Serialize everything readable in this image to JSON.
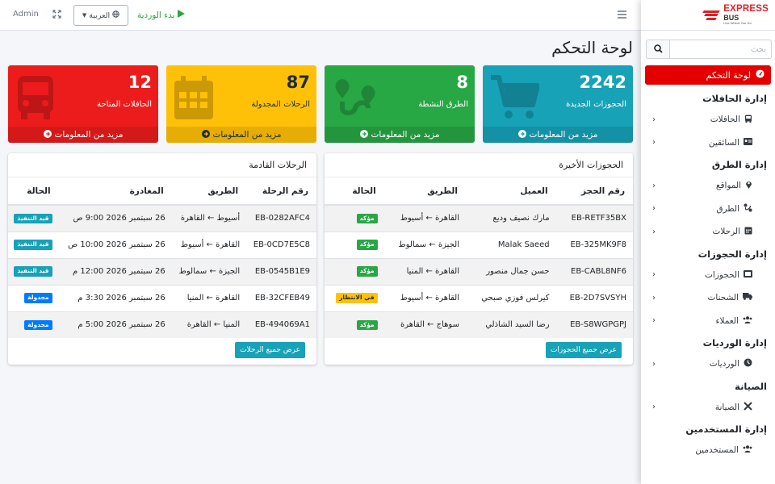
{
  "brand": {
    "line1": "EXPRESS",
    "line2": "BUS",
    "line3": "Live Where You Go",
    "accent": "#e31e24"
  },
  "topbar": {
    "user": "Admin",
    "language": "العربية",
    "start_shift": "بدء الوردية"
  },
  "sidebar": {
    "search_placeholder": "بحث",
    "active_item": "لوحة التحكم",
    "sections": [
      {
        "header": "إدارة الحافلات",
        "items": [
          {
            "label": "الحافلات",
            "icon": "bus-icon"
          },
          {
            "label": "السائقين",
            "icon": "id-card-icon"
          }
        ]
      },
      {
        "header": "إدارة الطرق",
        "items": [
          {
            "label": "المواقع",
            "icon": "map-marker-icon"
          },
          {
            "label": "الطرق",
            "icon": "route-icon"
          },
          {
            "label": "الرحلات",
            "icon": "calendar-icon"
          }
        ]
      },
      {
        "header": "إدارة الحجوزات",
        "items": [
          {
            "label": "الحجوزات",
            "icon": "ticket-icon"
          },
          {
            "label": "الشحنات",
            "icon": "truck-icon"
          },
          {
            "label": "العملاء",
            "icon": "users-icon"
          }
        ]
      },
      {
        "header": "إدارة الورديات",
        "items": [
          {
            "label": "الورديات",
            "icon": "clock-icon"
          }
        ]
      },
      {
        "header": "الصيانة",
        "items": [
          {
            "label": "الصيانة",
            "icon": "tools-icon"
          }
        ]
      },
      {
        "header": "إدارة المستخدمين",
        "items": [
          {
            "label": "المستخدمين",
            "icon": "users-icon"
          }
        ]
      }
    ]
  },
  "page": {
    "title": "لوحة التحكم"
  },
  "stats": [
    {
      "value": "2242",
      "label": "الحجوزات الجديدة",
      "footer": "مزيد من المعلومات",
      "color": "#17a2b8",
      "icon": "cart-icon"
    },
    {
      "value": "8",
      "label": "الطرق النشطة",
      "footer": "مزيد من المعلومات",
      "color": "#28a745",
      "icon": "route-icon"
    },
    {
      "value": "87",
      "label": "الرحلات المجدولة",
      "footer": "مزيد من المعلومات",
      "color": "#ffc107",
      "icon": "calendar-icon"
    },
    {
      "value": "12",
      "label": "الحافلات المتاحة",
      "footer": "مزيد من المعلومات",
      "color": "#ed1c1c",
      "icon": "bus-icon"
    }
  ],
  "recent_bookings": {
    "title": "الحجوزات الأخيرة",
    "columns": [
      "رقم الحجز",
      "العميل",
      "الطريق",
      "الحالة"
    ],
    "rows": [
      {
        "id": "EB-RETF35BX",
        "customer": "مارك نصيف وديع",
        "route": "القاهرة ← أسيوط",
        "status": "مؤكد"
      },
      {
        "id": "EB-325MK9F8",
        "customer": "Malak Saeed",
        "route": "الجيزة ← سمالوط",
        "status": "مؤكد"
      },
      {
        "id": "EB-CABL8NF6",
        "customer": "حسن جمال منصور",
        "route": "القاهرة ← المنيا",
        "status": "مؤكد"
      },
      {
        "id": "EB-2D7SVSYH",
        "customer": "كيرلس فوزي صبحي",
        "route": "القاهرة ← أسيوط",
        "status": "في الانتظار"
      },
      {
        "id": "EB-S8WGPGPJ",
        "customer": "رضا السيد الشاذلي",
        "route": "سوهاج ← القاهرة",
        "status": "مؤكد"
      }
    ],
    "button": "عرض جميع الحجوزات"
  },
  "upcoming_trips": {
    "title": "الرحلات القادمة",
    "columns": [
      "رقم الرحلة",
      "الطريق",
      "المغادرة",
      "الحالة"
    ],
    "rows": [
      {
        "id": "EB-0282AFC4",
        "route": "أسيوط ← القاهرة",
        "departure": "26 سبتمبر 2026 9:00 ص",
        "status": "قيد التنفيذ"
      },
      {
        "id": "EB-0CD7E5C8",
        "route": "القاهرة ← أسيوط",
        "departure": "26 سبتمبر 2026 10:00 ص",
        "status": "قيد التنفيذ"
      },
      {
        "id": "EB-0545B1E9",
        "route": "الجيزة ← سمالوط",
        "departure": "26 سبتمبر 2026 12:00 م",
        "status": "قيد التنفيذ"
      },
      {
        "id": "EB-32CFEB49",
        "route": "القاهرة ← المنيا",
        "departure": "26 سبتمبر 2026 3:30 م",
        "status": "مجدولة"
      },
      {
        "id": "EB-494069A1",
        "route": "المنيا ← القاهرة",
        "departure": "26 سبتمبر 2026 5:00 م",
        "status": "مجدولة"
      }
    ],
    "button": "عرض جميع الرحلات"
  }
}
